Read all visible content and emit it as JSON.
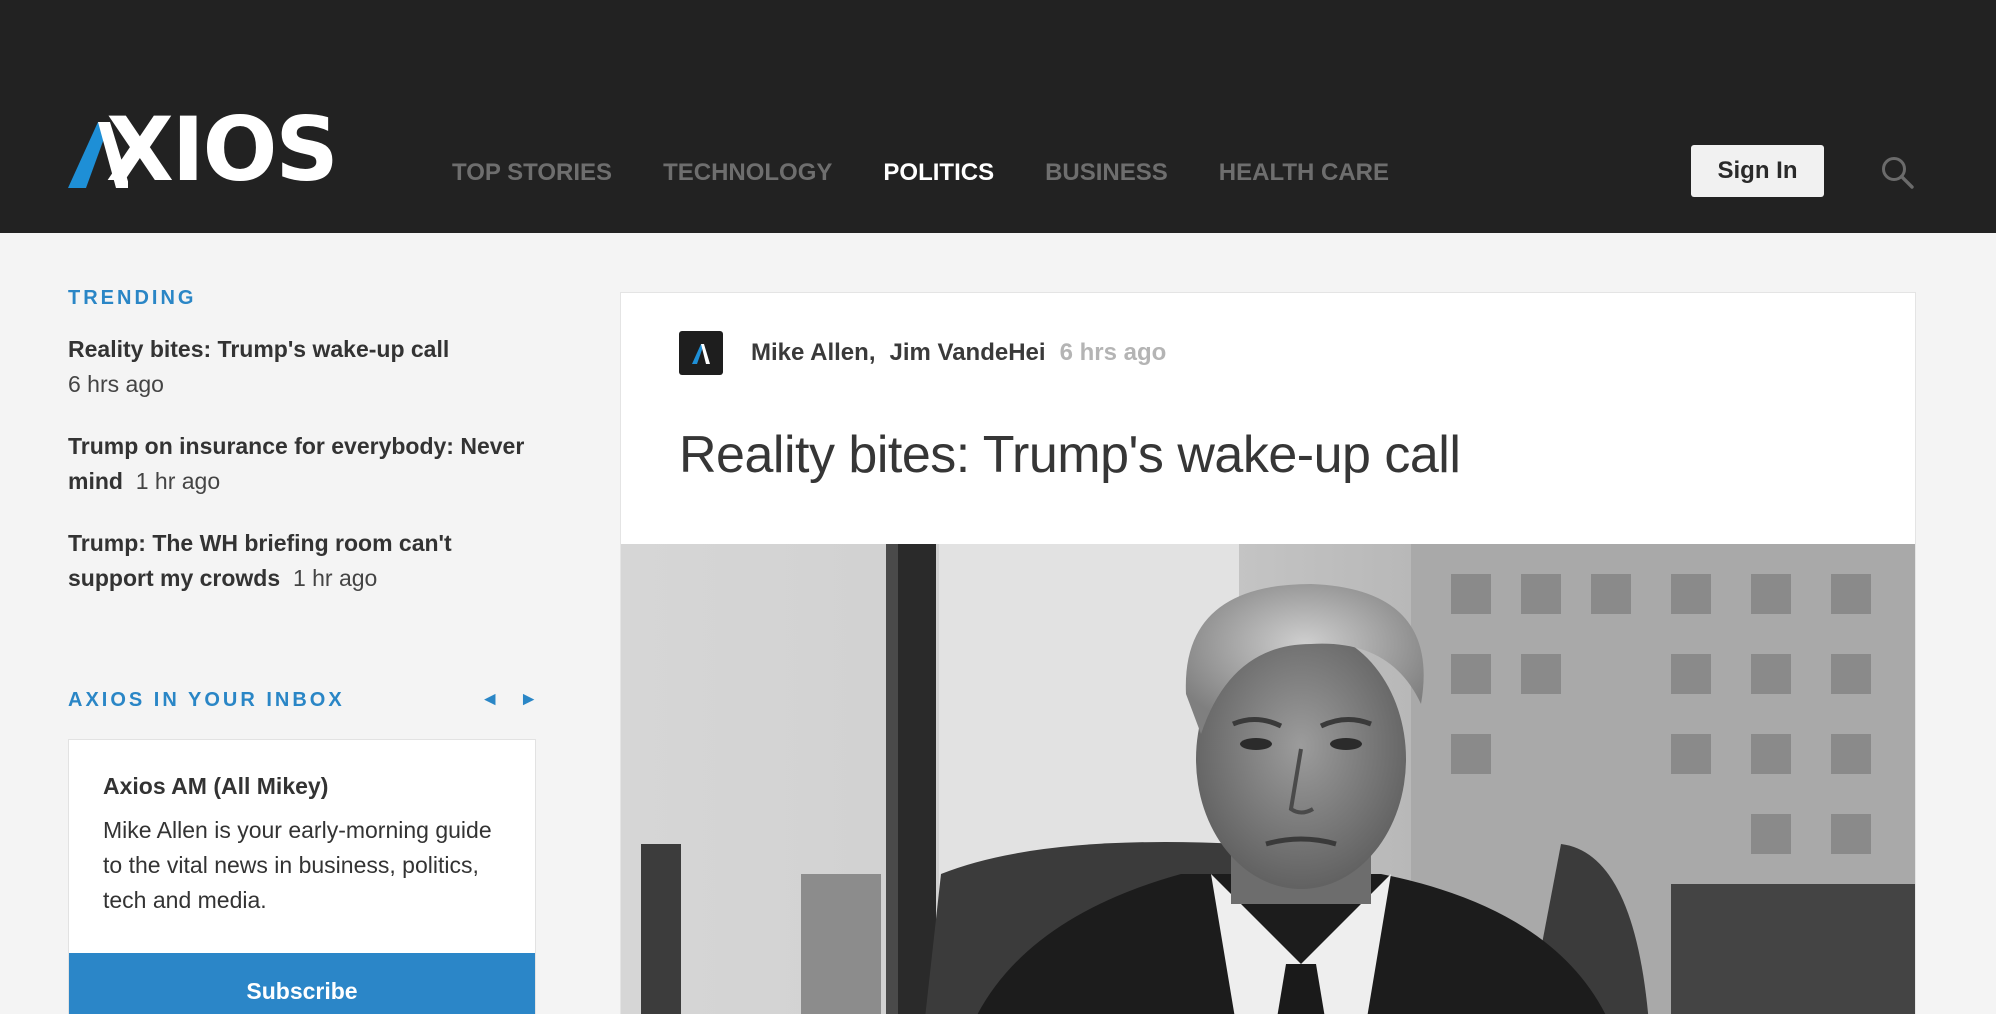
{
  "header": {
    "logo_text": "XIOS",
    "logo_alt": "AXIOS",
    "nav": [
      {
        "label": "TOP STORIES",
        "active": false
      },
      {
        "label": "TECHNOLOGY",
        "active": false
      },
      {
        "label": "POLITICS",
        "active": true
      },
      {
        "label": "BUSINESS",
        "active": false
      },
      {
        "label": "HEALTH CARE",
        "active": false
      }
    ],
    "sign_in_label": "Sign In",
    "search_icon": "search-icon"
  },
  "sidebar": {
    "trending_label": "TRENDING",
    "trending": [
      {
        "title": "Reality bites: Trump's wake-up call",
        "time": "6 hrs ago"
      },
      {
        "title": "Trump on insurance for everybody: Never mind",
        "time": "1 hr ago"
      },
      {
        "title": "Trump: The WH briefing room can't support my crowds",
        "time": "1 hr ago"
      }
    ],
    "inbox_label": "AXIOS IN YOUR INBOX",
    "prev_arrow": "◄",
    "next_arrow": "►",
    "newsletter": {
      "title": "Axios AM (All Mikey)",
      "description": "Mike Allen is your early-morning guide to the vital news in business, politics, tech and media.",
      "subscribe_label": "Subscribe"
    }
  },
  "article": {
    "authors": [
      "Mike Allen",
      "Jim VandeHei"
    ],
    "author_separator": ",",
    "time": "6 hrs ago",
    "headline": "Reality bites: Trump's wake-up call"
  },
  "colors": {
    "header_bg": "#222222",
    "accent_blue": "#2a86c6",
    "logo_blue": "#1e8fd6",
    "page_bg": "#f4f4f4"
  }
}
